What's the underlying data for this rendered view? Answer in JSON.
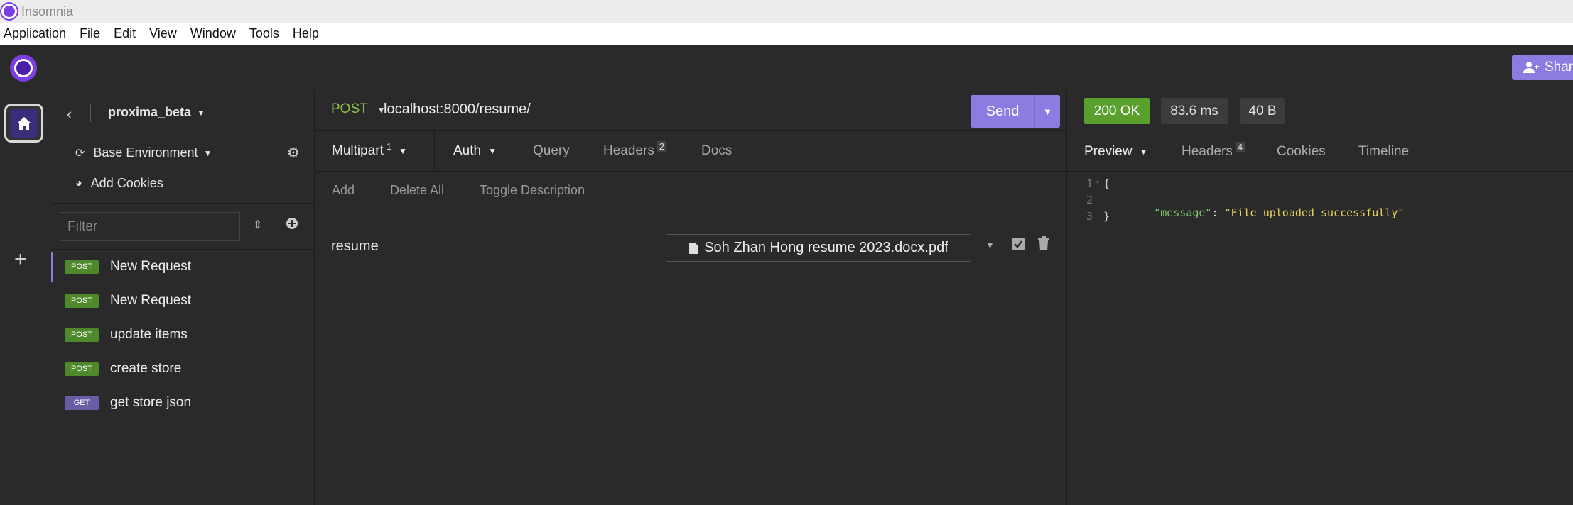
{
  "window": {
    "title": "Insomnia"
  },
  "menu": [
    "Application",
    "File",
    "Edit",
    "View",
    "Window",
    "Tools",
    "Help"
  ],
  "header": {
    "share_label": "Shar"
  },
  "colors": {
    "accent": "#8e7be2",
    "post": "#4e8a2c",
    "get": "#6b5ca8",
    "ok": "#5aa02c"
  },
  "sidebar": {
    "project": "proxima_beta",
    "environment": "Base Environment",
    "cookies": "Add Cookies",
    "filter_placeholder": "Filter",
    "requests": [
      {
        "method": "POST",
        "name": "New Request"
      },
      {
        "method": "POST",
        "name": "New Request"
      },
      {
        "method": "POST",
        "name": "update items"
      },
      {
        "method": "POST",
        "name": "create store"
      },
      {
        "method": "GET",
        "name": "get store json"
      }
    ]
  },
  "request": {
    "method": "POST",
    "url": "localhost:8000/resume/",
    "send_label": "Send",
    "tabs": {
      "body": "Multipart",
      "body_count": "1",
      "auth": "Auth",
      "query": "Query",
      "headers": "Headers",
      "headers_count": "2",
      "docs": "Docs"
    },
    "tools": {
      "add": "Add",
      "delete_all": "Delete All",
      "toggle": "Toggle Description"
    },
    "param": {
      "name": "resume",
      "file": "Soh Zhan Hong resume 2023.docx.pdf"
    }
  },
  "response": {
    "status": "200 OK",
    "time": "83.6 ms",
    "size": "40 B",
    "tabs": {
      "preview": "Preview",
      "headers": "Headers",
      "headers_count": "4",
      "cookies": "Cookies",
      "timeline": "Timeline"
    },
    "lines": [
      {
        "n": "1",
        "text": "{"
      },
      {
        "n": "2",
        "key": "\"message\"",
        "sep": ": ",
        "value": "\"File uploaded successfully\""
      },
      {
        "n": "3",
        "text": "}"
      }
    ]
  }
}
